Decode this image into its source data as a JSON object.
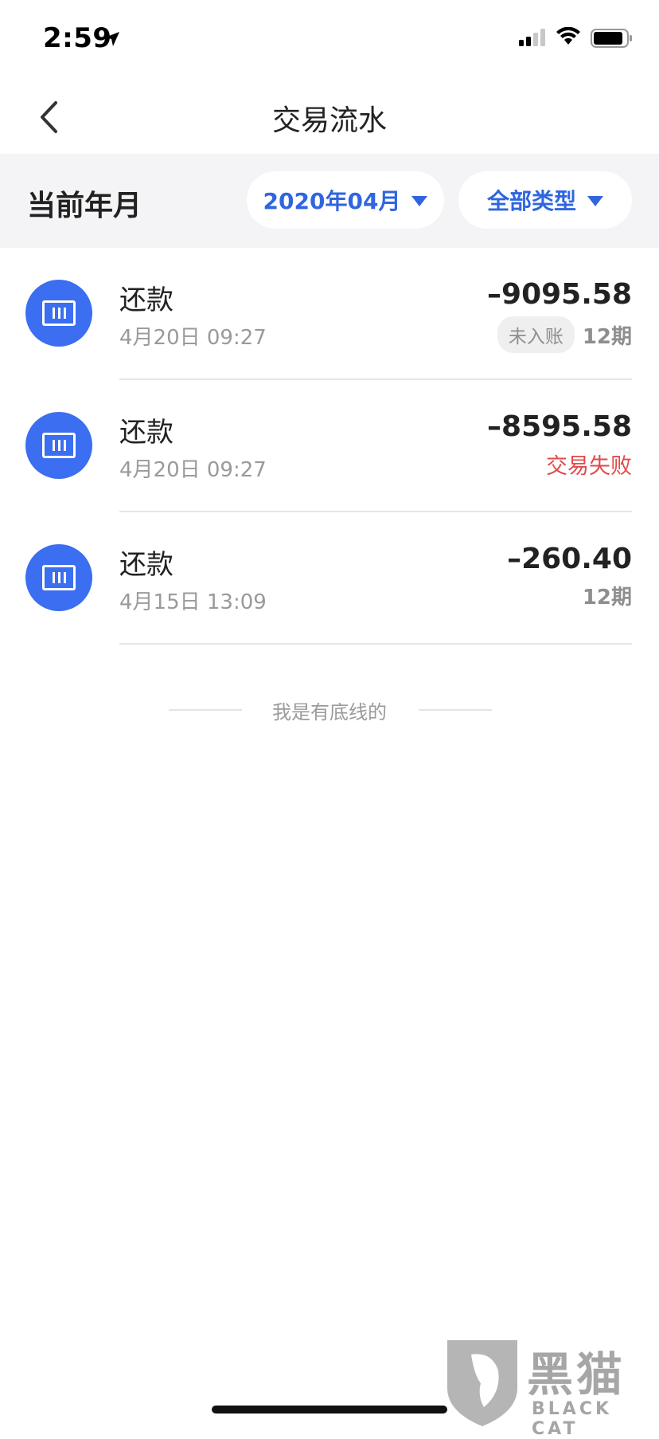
{
  "status_bar": {
    "time": "2:59"
  },
  "nav": {
    "title": "交易流水"
  },
  "filter": {
    "label": "当前年月",
    "date_value": "2020年04月",
    "type_value": "全部类型",
    "accent_color": "#2f66e0"
  },
  "transactions": [
    {
      "title": "还款",
      "time": "4月20日 09:27",
      "amount": "–9095.58",
      "badge": "未入账",
      "period": "12期",
      "status": ""
    },
    {
      "title": "还款",
      "time": "4月20日 09:27",
      "amount": "–8595.58",
      "badge": "",
      "period": "",
      "status": "交易失败"
    },
    {
      "title": "还款",
      "time": "4月15日 13:09",
      "amount": "–260.40",
      "badge": "",
      "period": "12期",
      "status": ""
    }
  ],
  "end_marker": "我是有底线的",
  "watermark": {
    "zh": "黑猫",
    "en": "BLACK CAT"
  },
  "colors": {
    "icon_bg": "#3b6ef0",
    "fail_red": "#e24a4a"
  }
}
